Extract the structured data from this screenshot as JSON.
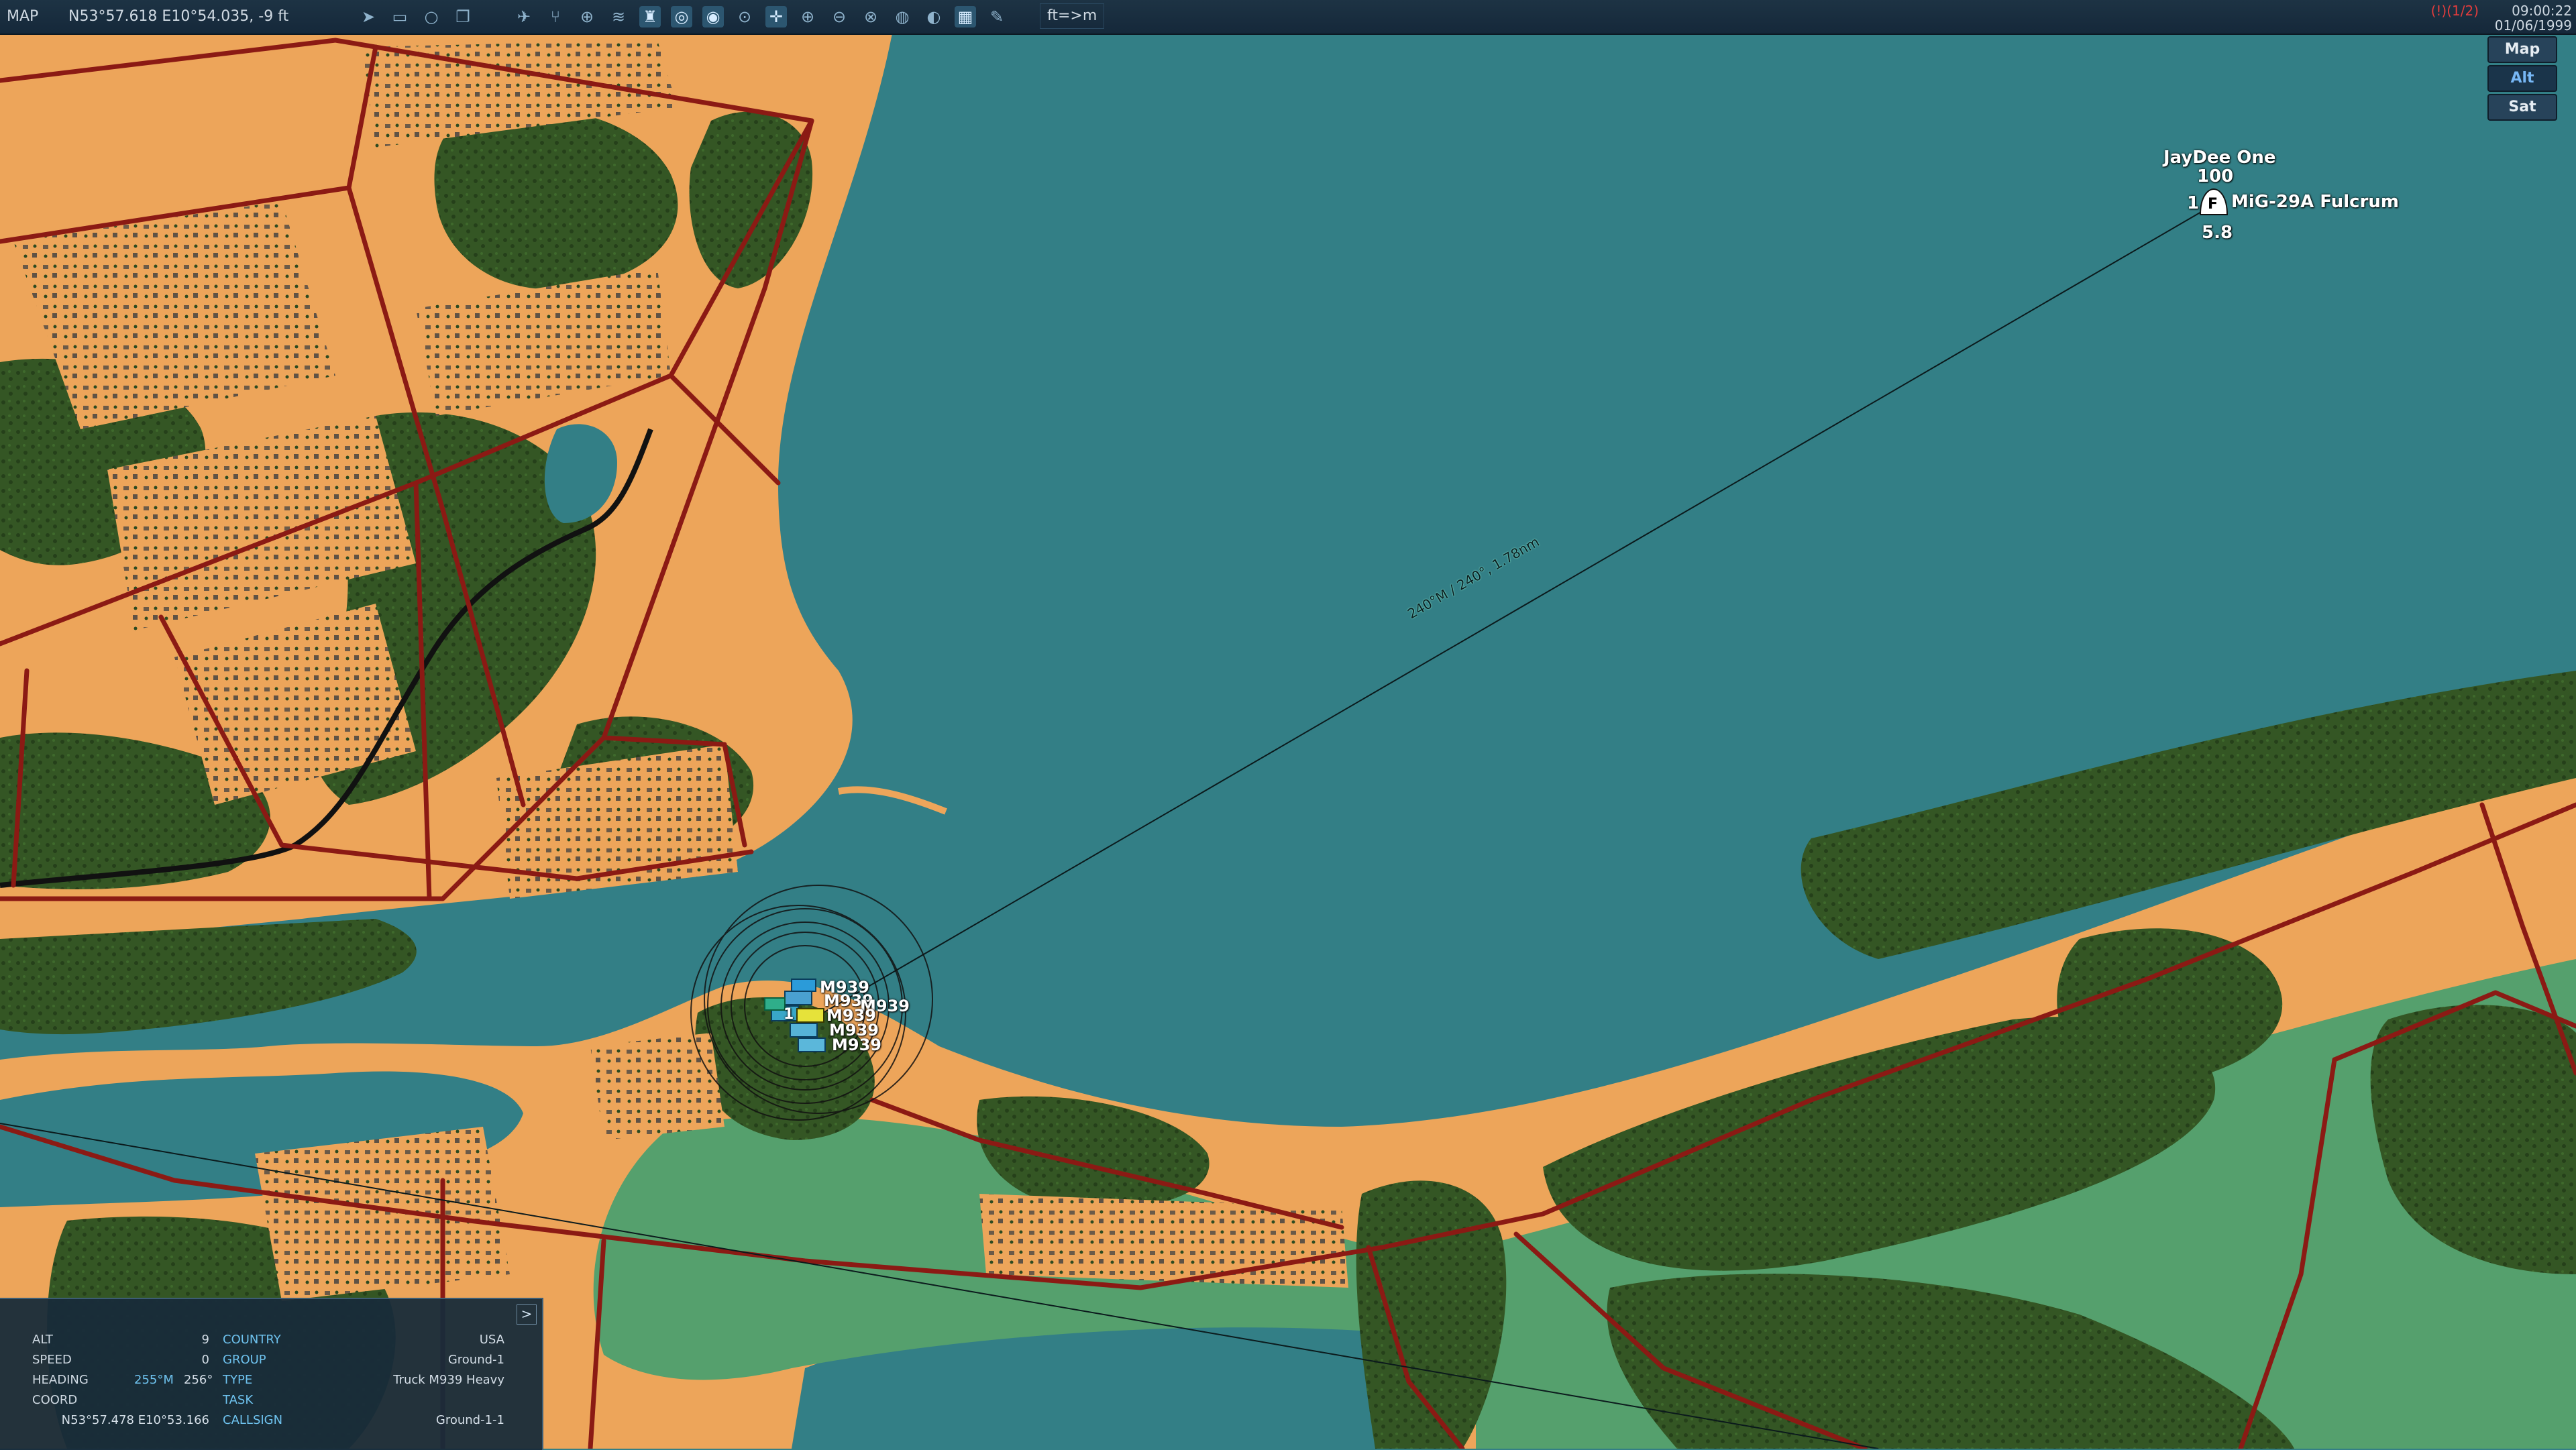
{
  "topbar": {
    "mode_label": "MAP",
    "coords": "N53°57.618 E10°54.035, -9 ft",
    "units_toggle": "ft=>m",
    "status": "(!)(1/2)",
    "time": "09:00:22",
    "date": "01/06/1999"
  },
  "toolbar_icons": [
    "navigate-icon",
    "ruler-icon",
    "circle-icon",
    "layers-icon",
    "aircraft-filter-icon",
    "route-icon",
    "target-icon",
    "signal-icon",
    "tower-icon",
    "zoom-region-icon",
    "zoom-out-region-icon",
    "zoom-unit-icon",
    "crosshair-icon",
    "zoom-in-icon",
    "zoom-out-icon",
    "zoom-fit-icon",
    "threat-icon",
    "globe-icon",
    "grid-icon",
    "pencil-icon"
  ],
  "map_modes": [
    {
      "label": "Map",
      "selected": false
    },
    {
      "label": "Alt",
      "selected": true
    },
    {
      "label": "Sat",
      "selected": false
    }
  ],
  "aircraft": {
    "callsign": "JayDee One",
    "altitude": "100",
    "count": "1",
    "symbol": "F",
    "type": "MiG-29A Fulcrum",
    "speed": "5.8"
  },
  "measure_label": "240°M / 240°, 1.78nm",
  "ground_units": {
    "count": "1",
    "labels": [
      "M939",
      "M939",
      "M939",
      "M939",
      "M939",
      "M939"
    ]
  },
  "info_panel": {
    "expand_label": ">",
    "alt_label": "ALT",
    "alt_value": "9",
    "speed_label": "SPEED",
    "speed_value": "0",
    "heading_label": "HEADING",
    "heading_mag": "255°M",
    "heading_true": "256°",
    "coord_label": "COORD",
    "coord_value": "N53°57.478 E10°53.166",
    "country_label": "COUNTRY",
    "country_value": "USA",
    "group_label": "GROUP",
    "group_value": "Ground-1",
    "type_label": "TYPE",
    "type_value": "Truck M939 Heavy",
    "task_label": "TASK",
    "task_value": "",
    "callsign_label": "CALLSIGN",
    "callsign_value": "Ground-1-1"
  },
  "colors": {
    "water": "#337f86",
    "sand": "#eda55a",
    "forest": "#345624",
    "meadow": "#55a06d",
    "road": "#8b1a14",
    "topbar": "#1a2f40",
    "panel": "#182b3a",
    "accent": "#6ec2ee"
  }
}
